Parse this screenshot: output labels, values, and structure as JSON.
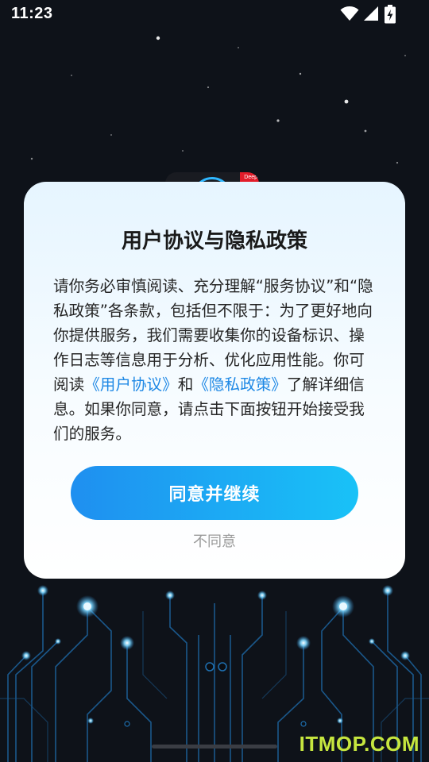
{
  "status_bar": {
    "time": "11:23",
    "icons": [
      "wifi-icon",
      "cell-signal-icon",
      "battery-charging-icon"
    ]
  },
  "background": {
    "description_icon": "starfield-circuit-background"
  },
  "app_icon": {
    "badge_text": "Deep"
  },
  "dialog": {
    "title": "用户协议与隐私政策",
    "body_parts": {
      "p1": "请你务必审慎阅读、充分理解“服务协议”和“隐私政策”各条款，包括但不限于：为了更好地向你提供服务，我们需要收集你的设备标识、操作日志等信息用于分析、优化应用性能。你可阅读",
      "link_user_agreement": "《用户协议》",
      "p2": "和",
      "link_privacy_policy": "《隐私政策》",
      "p3": "了解详细信息。如果你同意，请点击下面按钮开始接受我们的服务。"
    },
    "agree_label": "同意并继续",
    "disagree_label": "不同意"
  },
  "watermark": "ITMOP.COM",
  "colors": {
    "link": "#1e88e5",
    "button_start": "#1f8ff0",
    "button_end": "#19c2f7",
    "watermark": "#c6e63f"
  }
}
